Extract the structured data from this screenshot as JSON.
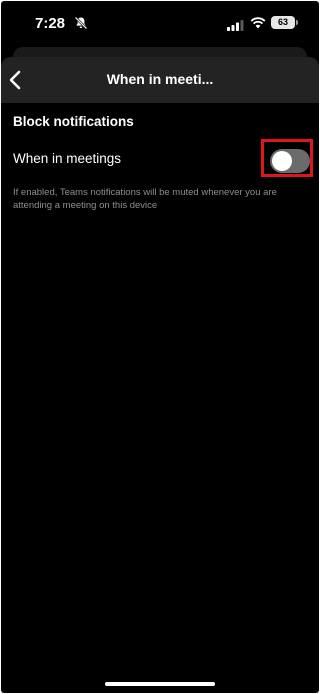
{
  "status_bar": {
    "time": "7:28",
    "battery": "63"
  },
  "header": {
    "title": "When in meeti..."
  },
  "settings": {
    "section_title": "Block notifications",
    "row_label": "When in meetings",
    "toggle_on": false,
    "helper_text": "If enabled, Teams notifications will be muted whenever you are attending a meeting on this device"
  },
  "colors": {
    "background": "#000000",
    "header_bg": "#232323",
    "highlight": "#e0141b",
    "toggle_off": "#6b6b6b",
    "helper_text": "#8e8e8e"
  },
  "icons": {
    "bell": "bell-slash-icon",
    "signal": "cellular-signal-icon",
    "wifi": "wifi-icon",
    "back": "chevron-left-icon"
  }
}
